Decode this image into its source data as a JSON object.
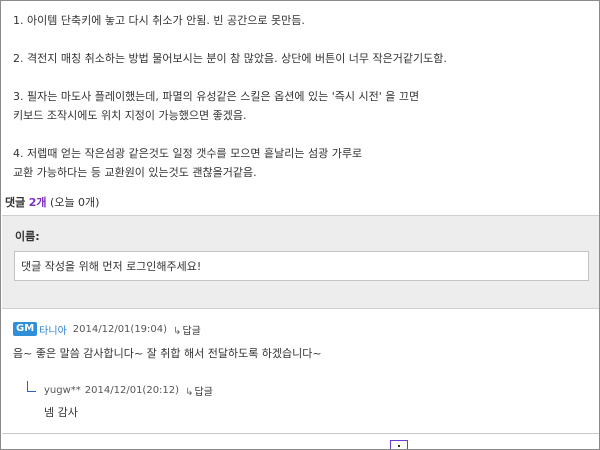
{
  "post": {
    "paragraphs": [
      [
        "1. 아이템 단축키에 놓고 다시 취소가 안됨. 빈 공간으로 못만듬."
      ],
      [
        "2. 격전지 매칭 취소하는 방법 물어보시는 분이 참 많았음. 상단에 버튼이 너무 작은거같기도함."
      ],
      [
        "3. 필자는 마도사 플레이했는데, 파멸의 유성같은 스킬은 옵션에 있는 '즉시 시전' 을 끄면",
        "키보드 조작시에도 위치 지정이 가능했으면 좋겠음."
      ],
      [
        "4. 저렙때 얻는 작은섬광 같은것도 일정 갯수를 모으면 흩날리는 섬광 가루로",
        "교환 가능하다는 등 교환원이 있는것도 괜찮을거같음."
      ]
    ]
  },
  "comments_summary": {
    "label": "댓글",
    "count": "2개",
    "today": "(오늘 0개)"
  },
  "form": {
    "name_label": "이름:",
    "login_prompt": "댓글 작성을 위해 먼저 로그인해주세요!"
  },
  "comment": {
    "badge": "GM",
    "author": "타니아",
    "date": "2014/12/01(19:04)",
    "reply_label": "답글",
    "body": "음~ 좋은 말씀 감사합니다~ 잘 취합 해서 전달하도록 하겠습니다~"
  },
  "subcomment": {
    "author": "yugw**",
    "date": "2014/12/01(20:12)",
    "reply_label": "답글",
    "body": "넴 감사"
  },
  "colors": {
    "accent_purple": "#7b2fbf",
    "gm_blue": "#2f8fd8",
    "author_blue": "#2a7fd0",
    "form_bg": "#ededed"
  },
  "icons": {
    "reply": "reply-arrow-icon",
    "subcomment": "nested-reply-corner-icon"
  }
}
